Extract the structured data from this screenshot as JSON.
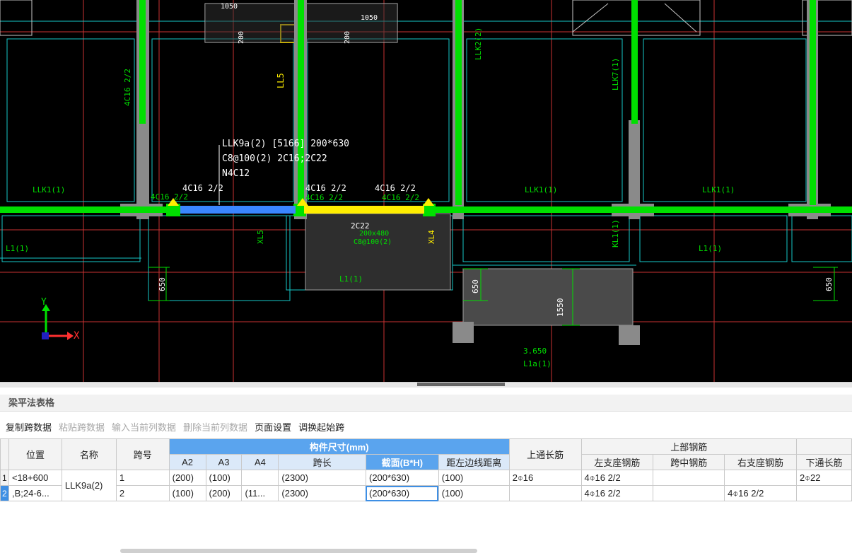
{
  "cad": {
    "text_lines": {
      "beam_name_line": "LLK9a(2) [5166] 200*630",
      "beam_stirrup_line": "C8@100(2) 2C16;2C22",
      "beam_bottom_line": "N4C12"
    },
    "labels": {
      "llk1_a": "LLK1(1)",
      "llk1_b": "LLK1(1)",
      "llk1_c": "LLK1(1)",
      "rebar_left_top": "4C16 2/2",
      "rebar_left_seg": "4C16 2/2",
      "rebar_mid_top": "4C16 2/2",
      "rebar_mid_seg": "4C16 2/2",
      "rebar_right_top": "4C16 2/2",
      "rebar_right_seg": "4C16 2/2",
      "vert_4c16": "4C16 2/2",
      "ll5": "LL5",
      "llk2": "LLK2(2)",
      "llk7": "LLK7(1)",
      "kl1": "KL1(1)",
      "l1_left": "L1(1)",
      "l1_right": "L1(1)",
      "l1_mid": "L1(1)",
      "l1a": "L1a(1)",
      "elev": "3.650",
      "dim_650_left": "650",
      "dim_650_right": "650",
      "dim_650_mid": "650",
      "dim_1550": "1550",
      "dim_1050_left": "1050",
      "dim_1050_right": "1050",
      "dim_200": "200",
      "dim_200b": "200",
      "beam_2c22": "2C22",
      "beam_200x480": "200x480",
      "beam_c8": "C8@100(2)",
      "xl4": "XL4",
      "xl5": "XL5"
    },
    "axis": {
      "x": "X",
      "y": "Y"
    }
  },
  "panel": {
    "title": "梁平法表格",
    "toolbar": [
      {
        "label": "复制跨数据",
        "enabled": true
      },
      {
        "label": "粘贴跨数据",
        "enabled": false
      },
      {
        "label": "输入当前列数据",
        "enabled": false
      },
      {
        "label": "删除当前列数据",
        "enabled": false
      },
      {
        "label": "页面设置",
        "enabled": true
      },
      {
        "label": "调换起始跨",
        "enabled": true
      }
    ]
  },
  "table": {
    "headers": {
      "position": "位置",
      "name": "名称",
      "span": "跨号",
      "dims_group": "构件尺寸(mm)",
      "a2": "A2",
      "a3": "A3",
      "a4": "A4",
      "span_len": "跨长",
      "section": "截面(B*H)",
      "edge_dist": "距左边线距离",
      "top_through": "上通长筋",
      "top_group": "上部钢筋",
      "left_support": "左支座钢筋",
      "mid_span": "跨中钢筋",
      "right_support": "右支座钢筋",
      "bottom_through": "下通长筋"
    },
    "rows": [
      {
        "num": "1",
        "position": "<18+600",
        "name": "LLK9a(2)",
        "span": "1",
        "a2": "(200)",
        "a3": "(100)",
        "a4": "",
        "span_len": "(2300)",
        "section": "(200*630)",
        "edge_dist": "(100)",
        "top_through": "2⌽16",
        "left_support": "4⌽16 2/2",
        "mid_span": "",
        "right_support": "",
        "bottom_through": "2⌽22"
      },
      {
        "num": "2",
        "position": ",B;24-6...",
        "name": "",
        "span": "2",
        "a2": "(100)",
        "a3": "(200)",
        "a4": "(11...",
        "span_len": "(2300)",
        "section": "(200*630)",
        "edge_dist": "(100)",
        "top_through": "",
        "left_support": "4⌽16 2/2",
        "mid_span": "",
        "right_support": "4⌽16 2/2",
        "bottom_through": ""
      }
    ]
  },
  "colors": {
    "cad_bg": "#000000",
    "beam_green": "#00e000",
    "column_gray": "#8a8a8a",
    "selected_beam": "#ffee00",
    "selected_beam_blue": "#3a86ff",
    "header_blue": "#5aa4ee"
  }
}
